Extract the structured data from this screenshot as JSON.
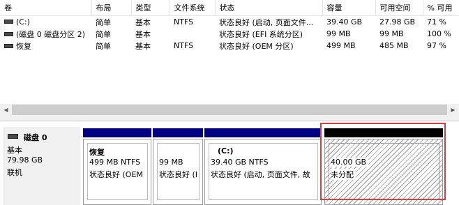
{
  "columns": [
    "卷",
    "布局",
    "类型",
    "文件系统",
    "状态",
    "容量",
    "可用空间",
    "% 可用"
  ],
  "volumes": [
    {
      "name": "(C:)",
      "layout": "简单",
      "type": "基本",
      "fs": "NTFS",
      "status": "状态良好 (启动, 页面文件...",
      "capacity": "39.40 GB",
      "free": "27.98 GB",
      "pct": "71 %"
    },
    {
      "name": "(磁盘 0 磁盘分区 2)",
      "layout": "简单",
      "type": "基本",
      "fs": "",
      "status": "状态良好 (EFI 系统分区)",
      "capacity": "99 MB",
      "free": "99 MB",
      "pct": "100 %"
    },
    {
      "name": "恢复",
      "layout": "简单",
      "type": "基本",
      "fs": "NTFS",
      "status": "状态良好 (OEM 分区)",
      "capacity": "499 MB",
      "free": "485 MB",
      "pct": "97 %"
    }
  ],
  "disk": {
    "name": "磁盘 0",
    "kind": "基本",
    "size": "79.98 GB",
    "state": "联机"
  },
  "partitions": [
    {
      "name": "恢复",
      "size": "499 MB NTFS",
      "status": "状态良好 (OEM"
    },
    {
      "name": "",
      "size": "99 MB",
      "status": "状态良好 (I"
    },
    {
      "name": "(C:)",
      "size": "39.40 GB NTFS",
      "status": "状态良好 (启动, 页面文件, 故"
    },
    {
      "name": "",
      "size": "40.00 GB",
      "status": "未分配"
    }
  ],
  "icons": {
    "volume": "disk-volume-icon",
    "disk": "hard-disk-icon",
    "scroll_left": "chevron-left-icon",
    "scroll_right": "chevron-right-icon"
  },
  "colors": {
    "primary_partition_bar": "#000080",
    "unallocated_bar": "#000000",
    "highlight": "#e03a3a"
  }
}
